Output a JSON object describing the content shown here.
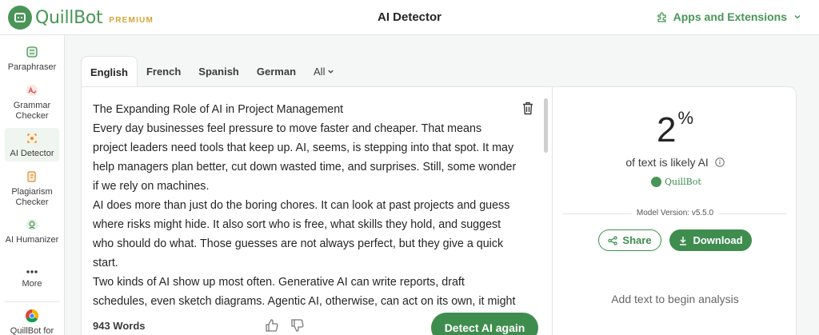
{
  "header": {
    "brand_name": "QuillBot",
    "brand_tier": "PREMIUM",
    "page_title": "AI Detector",
    "apps_label": "Apps and Extensions"
  },
  "sidebar": {
    "items": [
      {
        "label": "Paraphraser",
        "icon": "paraphraser-icon"
      },
      {
        "label": "Grammar Checker",
        "icon": "grammar-checker-icon"
      },
      {
        "label": "AI Detector",
        "icon": "ai-detector-icon",
        "active": true
      },
      {
        "label": "Plagiarism Checker",
        "icon": "plagiarism-checker-icon"
      },
      {
        "label": "AI Humanizer",
        "icon": "ai-humanizer-icon"
      },
      {
        "label": "More",
        "icon": "more-dots-icon"
      },
      {
        "label": "QuillBot for",
        "icon": "chrome-icon"
      }
    ]
  },
  "tabs": [
    {
      "label": "English",
      "active": true
    },
    {
      "label": "French"
    },
    {
      "label": "Spanish"
    },
    {
      "label": "German"
    },
    {
      "label": "All"
    }
  ],
  "editor": {
    "lines": [
      "The Expanding Role of AI in Project Management",
      "Every day businesses feel pressure to move faster and cheaper. That means project leaders need tools that keep up. AI, seems, is stepping into that spot. It may help managers plan better, cut down wasted time, and surprises. Still, some wonder if we rely on machines.",
      "AI does more than just do the boring chores. It can look at past projects and guess where risks might hide. It also sort who is free, what skills they hold, and suggest who should do what. Those guesses are not always perfect, but they give a quick start.",
      "Two kinds of AI show up most often. Generative AI can write reports, draft schedules, even sketch diagrams. Agentic AI, otherwise, can act on its own, it might"
    ],
    "word_count": "943 Words",
    "detect_button": "Detect AI again"
  },
  "result": {
    "percent_value": "2",
    "percent_sign": "%",
    "label": "of text is likely AI",
    "brand_mark": "QuillBot",
    "model_version": "Model Version: v5.5.0",
    "share_label": "Share",
    "download_label": "Download",
    "empty_hint": "Add text to begin analysis"
  },
  "colors": {
    "brand_green": "#499557",
    "button_green": "#3f8d4e",
    "premium_gold": "#d9a53a"
  }
}
